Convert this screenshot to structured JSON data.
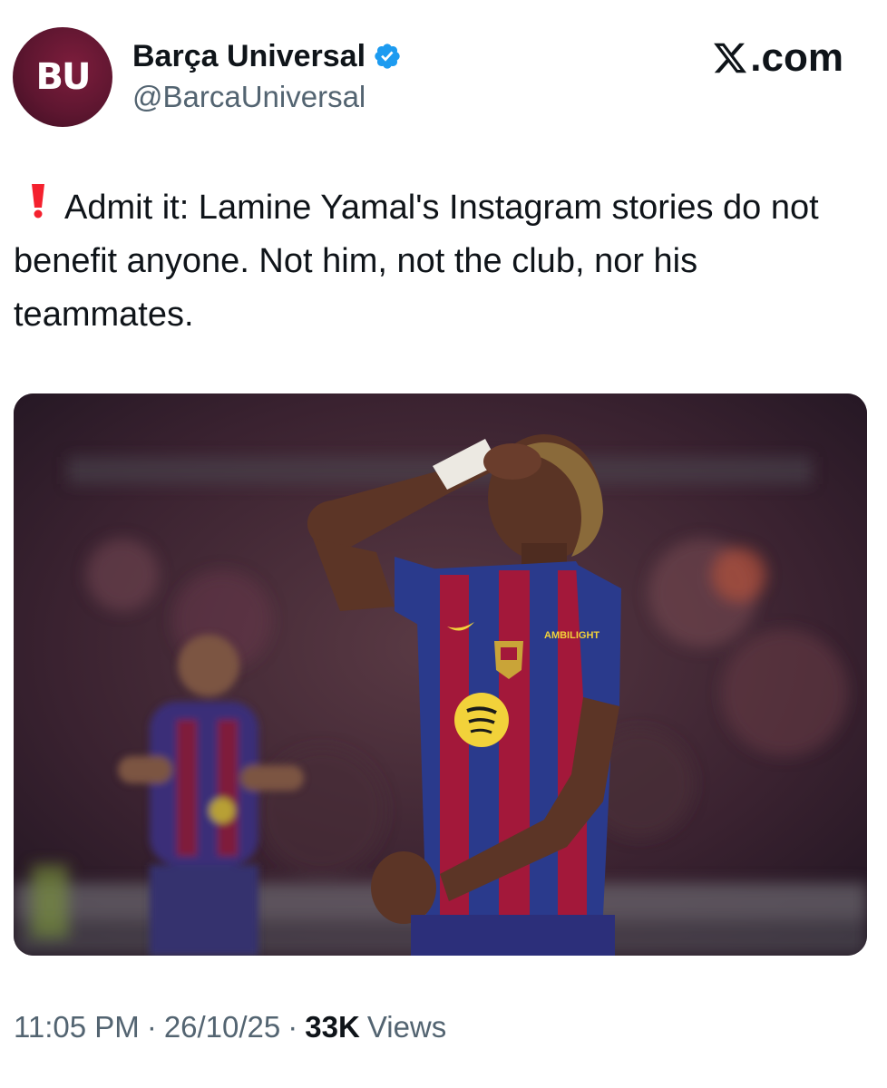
{
  "header": {
    "avatar_text": "BU",
    "display_name": "Barça Universal",
    "handle": "@BarcaUniversal",
    "verified_icon": "verified-badge-icon",
    "site_label": ".com"
  },
  "tweet": {
    "alert_icon": "red-exclamation-icon",
    "text": "Admit it: Lamine Yamal's Instagram stories do not benefit anyone. Not him, not the club, nor his teammates."
  },
  "media": {
    "description_icon": "photo",
    "jersey_sponsor_text": "AMBILIGHT"
  },
  "footer": {
    "time": "11:05 PM",
    "separator": "·",
    "date": "26/10/25",
    "views_count": "33K",
    "views_label": "Views"
  },
  "colors": {
    "text_primary": "#0f1419",
    "text_secondary": "#536471",
    "verified_blue": "#1d9bf0",
    "alert_red": "#f4212e",
    "barca_blue": "#2a3a8c",
    "barca_red": "#a3183a"
  }
}
